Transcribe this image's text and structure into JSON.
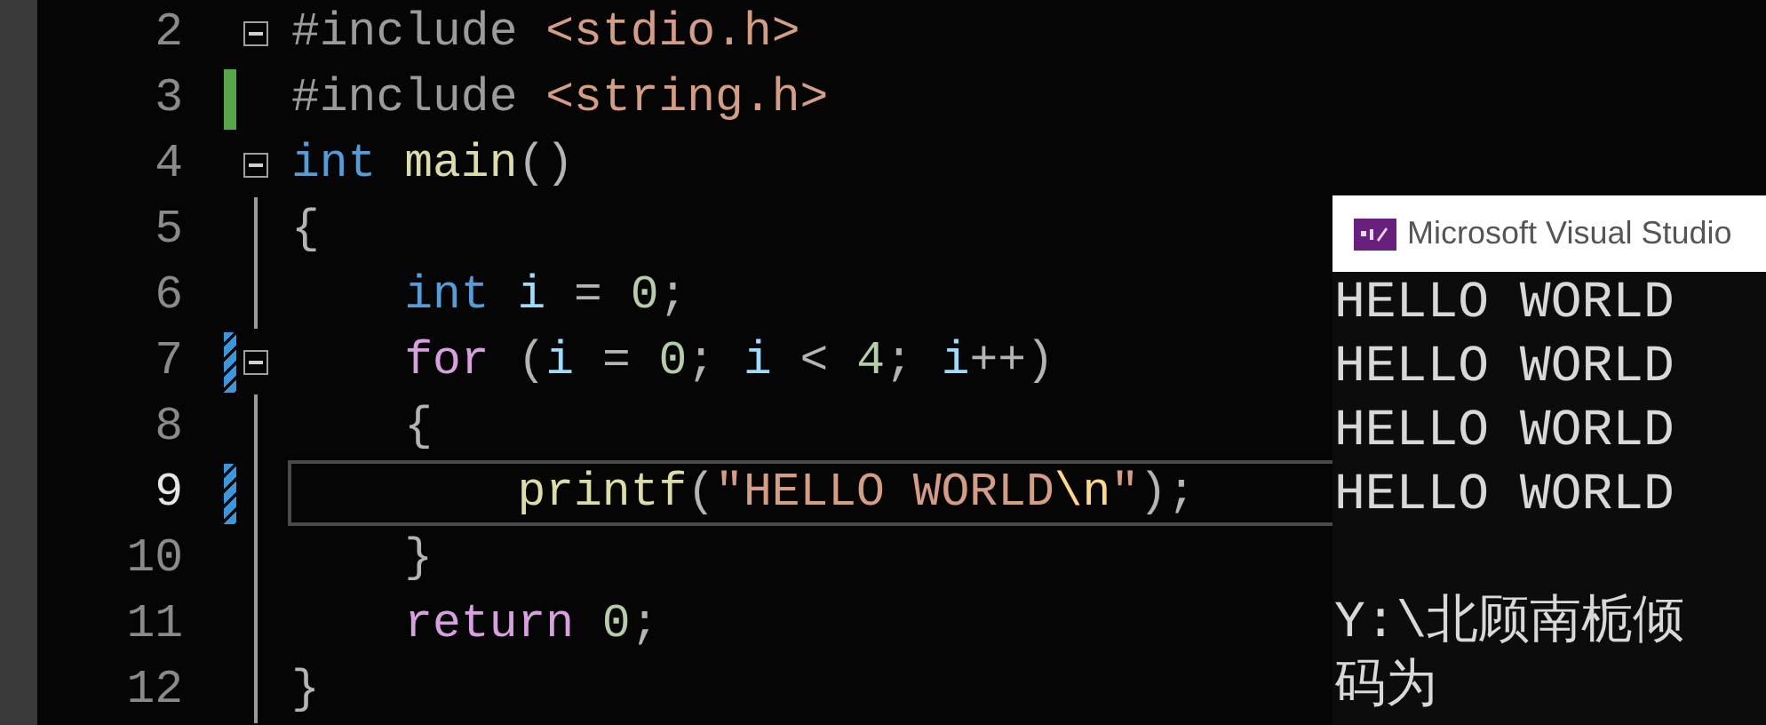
{
  "editor": {
    "lines": [
      {
        "number": "2",
        "selected": false,
        "fold": true,
        "tokens": [
          {
            "kind": "pre",
            "text": "#include"
          },
          {
            "kind": "str",
            "text": " <stdio.h>"
          }
        ]
      },
      {
        "number": "3",
        "selected": false,
        "change": {
          "kind": "saved"
        },
        "fold": false,
        "tokens": [
          {
            "kind": "pre",
            "text": "#include"
          },
          {
            "kind": "str",
            "text": " <string.h>"
          }
        ]
      },
      {
        "number": "4",
        "selected": false,
        "fold": true,
        "tokens": [
          {
            "kind": "kw",
            "text": "int"
          },
          {
            "kind": "fn",
            "text": " main"
          },
          {
            "kind": "punc",
            "text": "()"
          }
        ]
      },
      {
        "number": "5",
        "selected": false,
        "fold": false,
        "tokens": [
          {
            "kind": "punc",
            "text": "{"
          }
        ]
      },
      {
        "number": "6",
        "selected": false,
        "fold": false,
        "tokens": [
          {
            "kind": "kw",
            "text": "    int"
          },
          {
            "kind": "id",
            "text": " i"
          },
          {
            "kind": "punc",
            "text": " = "
          },
          {
            "kind": "num",
            "text": "0"
          },
          {
            "kind": "punc",
            "text": ";"
          }
        ]
      },
      {
        "number": "7",
        "selected": false,
        "change": {
          "kind": "unsaved"
        },
        "fold": true,
        "tokens": [
          {
            "kind": "ctl",
            "text": "    for"
          },
          {
            "kind": "punc",
            "text": " ("
          },
          {
            "kind": "id",
            "text": "i"
          },
          {
            "kind": "punc",
            "text": " = "
          },
          {
            "kind": "num",
            "text": "0"
          },
          {
            "kind": "punc",
            "text": "; "
          },
          {
            "kind": "id",
            "text": "i"
          },
          {
            "kind": "punc",
            "text": " < "
          },
          {
            "kind": "num",
            "text": "4"
          },
          {
            "kind": "punc",
            "text": "; "
          },
          {
            "kind": "id",
            "text": "i"
          },
          {
            "kind": "punc",
            "text": "++)"
          }
        ]
      },
      {
        "number": "8",
        "selected": false,
        "fold": false,
        "tokens": [
          {
            "kind": "punc",
            "text": "    {"
          }
        ]
      },
      {
        "number": "9",
        "selected": true,
        "change": {
          "kind": "unsaved"
        },
        "fold": false,
        "tokens": [
          {
            "kind": "fn",
            "text": "        printf"
          },
          {
            "kind": "punc",
            "text": "("
          },
          {
            "kind": "str",
            "text": "\"HELLO WORLD"
          },
          {
            "kind": "esc",
            "text": "\\n"
          },
          {
            "kind": "str",
            "text": "\""
          },
          {
            "kind": "punc",
            "text": ");"
          }
        ]
      },
      {
        "number": "10",
        "selected": false,
        "fold": false,
        "tokens": [
          {
            "kind": "punc",
            "text": "    }"
          }
        ]
      },
      {
        "number": "11",
        "selected": false,
        "fold": false,
        "tokens": [
          {
            "kind": "ctl",
            "text": "    return"
          },
          {
            "kind": "num",
            "text": " 0"
          },
          {
            "kind": "punc",
            "text": ";"
          }
        ]
      },
      {
        "number": "12",
        "selected": false,
        "fold": false,
        "tokens": [
          {
            "kind": "punc",
            "text": "}"
          }
        ]
      }
    ]
  },
  "console": {
    "title": "Microsoft Visual Studio",
    "output": [
      "HELLO WORLD",
      "HELLO WORLD",
      "HELLO WORLD",
      "HELLO WORLD"
    ],
    "footer": [
      "Y:\\北顾南栀倾",
      "码为"
    ]
  }
}
